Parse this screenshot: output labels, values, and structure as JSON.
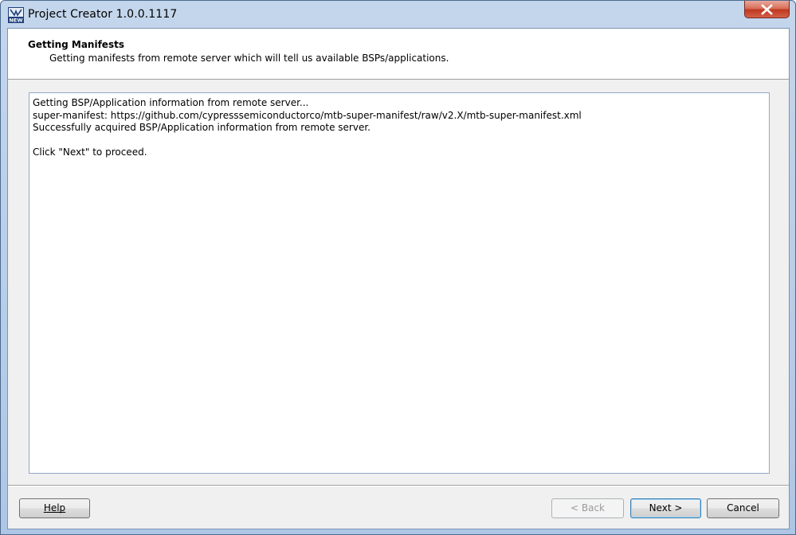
{
  "window": {
    "title": "Project Creator 1.0.0.1117",
    "icon": "project-creator-new-icon",
    "close_icon": "close-icon"
  },
  "header": {
    "title": "Getting Manifests",
    "subtitle": "Getting manifests from remote server which will tell us available BSPs/applications."
  },
  "log": {
    "lines": [
      "Getting BSP/Application information from remote server...",
      "super-manifest: https://github.com/cypresssemiconductorco/mtb-super-manifest/raw/v2.X/mtb-super-manifest.xml",
      "Successfully acquired BSP/Application information from remote server.",
      "",
      "Click \"Next\" to proceed."
    ]
  },
  "buttons": {
    "help": "Help",
    "back": "< Back",
    "next": "Next >",
    "cancel": "Cancel"
  }
}
